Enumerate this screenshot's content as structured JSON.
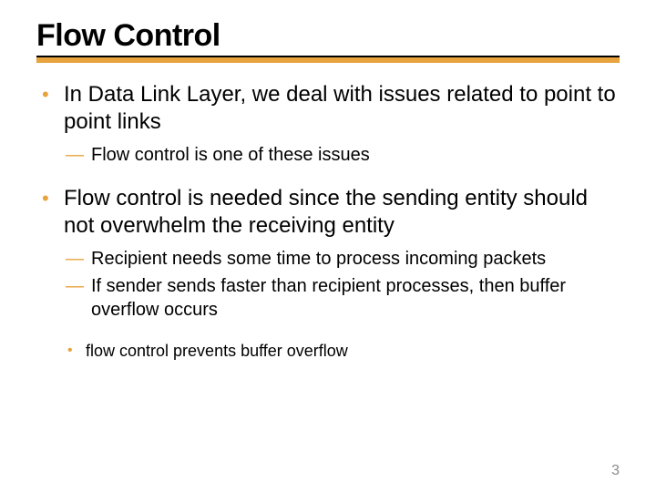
{
  "title": "Flow Control",
  "bullets": [
    {
      "text": "In Data Link Layer, we deal with issues related to point to point links",
      "sub": [
        {
          "text": "Flow control is one of these issues"
        }
      ]
    },
    {
      "text": "Flow control is needed since the sending entity should not overwhelm the receiving entity",
      "sub": [
        {
          "text": "Recipient needs some time to process incoming packets"
        },
        {
          "text": "If sender sends faster than recipient processes, then buffer overflow occurs",
          "sub": [
            {
              "text": "flow control prevents buffer overflow"
            }
          ]
        }
      ]
    }
  ],
  "page_number": "3"
}
